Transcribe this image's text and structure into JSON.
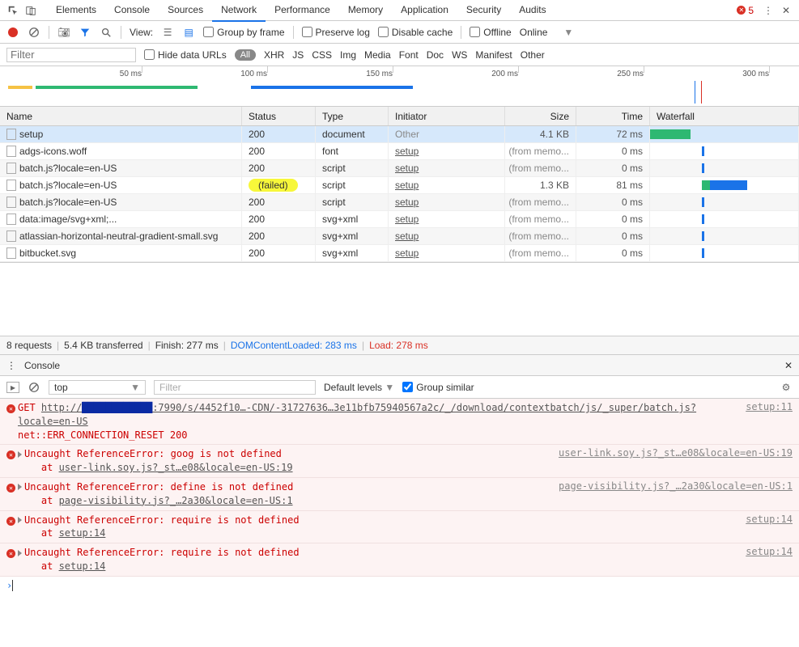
{
  "header": {
    "tabs": [
      "Elements",
      "Console",
      "Sources",
      "Network",
      "Performance",
      "Memory",
      "Application",
      "Security",
      "Audits"
    ],
    "active_tab": "Network",
    "error_count": "5"
  },
  "toolbar": {
    "view_label": "View:",
    "group_by_frame": "Group by frame",
    "preserve_log": "Preserve log",
    "disable_cache": "Disable cache",
    "offline": "Offline",
    "online": "Online"
  },
  "filter": {
    "placeholder": "Filter",
    "hide_data_urls": "Hide data URLs",
    "types": [
      "All",
      "XHR",
      "JS",
      "CSS",
      "Img",
      "Media",
      "Font",
      "Doc",
      "WS",
      "Manifest",
      "Other"
    ],
    "active_type": "All"
  },
  "timeline": {
    "ticks": [
      "50 ms",
      "100 ms",
      "150 ms",
      "200 ms",
      "250 ms",
      "300 ms"
    ]
  },
  "columns": {
    "name": "Name",
    "status": "Status",
    "type": "Type",
    "initiator": "Initiator",
    "size": "Size",
    "time": "Time",
    "waterfall": "Waterfall"
  },
  "rows": [
    {
      "name": "setup",
      "status": "200",
      "type": "document",
      "initiator": "Other",
      "init_link": false,
      "size": "4.1 KB",
      "time": "72 ms",
      "sel": true,
      "wf": {
        "l": 0,
        "w": 50,
        "c": "#2eb872"
      }
    },
    {
      "name": "adgs-icons.woff",
      "status": "200",
      "type": "font",
      "initiator": "setup",
      "init_link": true,
      "size": "(from memo...",
      "time": "0 ms",
      "wf": {
        "l": 64,
        "w": 3,
        "c": "#1a73e8"
      }
    },
    {
      "name": "batch.js?locale=en-US",
      "status": "200",
      "type": "script",
      "initiator": "setup",
      "init_link": true,
      "size": "(from memo...",
      "time": "0 ms",
      "alt": true,
      "wf": {
        "l": 64,
        "w": 3,
        "c": "#1a73e8"
      }
    },
    {
      "name": "batch.js?locale=en-US",
      "status": "(failed)",
      "hl": true,
      "type": "script",
      "initiator": "setup",
      "init_link": true,
      "size": "1.3 KB",
      "time": "81 ms",
      "wf": {
        "l": 64,
        "w": 56,
        "c": "#1a73e8",
        "g": 10
      }
    },
    {
      "name": "batch.js?locale=en-US",
      "status": "200",
      "type": "script",
      "initiator": "setup",
      "init_link": true,
      "size": "(from memo...",
      "time": "0 ms",
      "alt": true,
      "wf": {
        "l": 64,
        "w": 3,
        "c": "#1a73e8"
      }
    },
    {
      "name": "data:image/svg+xml;...",
      "status": "200",
      "type": "svg+xml",
      "initiator": "setup",
      "init_link": true,
      "size": "(from memo...",
      "time": "0 ms",
      "wf": {
        "l": 64,
        "w": 3,
        "c": "#1a73e8"
      }
    },
    {
      "name": "atlassian-horizontal-neutral-gradient-small.svg",
      "status": "200",
      "type": "svg+xml",
      "initiator": "setup",
      "init_link": true,
      "size": "(from memo...",
      "time": "0 ms",
      "alt": true,
      "wf": {
        "l": 64,
        "w": 3,
        "c": "#1a73e8"
      }
    },
    {
      "name": "bitbucket.svg",
      "status": "200",
      "type": "svg+xml",
      "initiator": "setup",
      "init_link": true,
      "size": "(from memo...",
      "time": "0 ms",
      "wf": {
        "l": 64,
        "w": 3,
        "c": "#1a73e8"
      }
    }
  ],
  "status": {
    "requests": "8 requests",
    "transferred": "5.4 KB transferred",
    "finish": "Finish: 277 ms",
    "dcl": "DOMContentLoaded: 283 ms",
    "load": "Load: 278 ms"
  },
  "console": {
    "title": "Console",
    "context": "top",
    "filter_placeholder": "Filter",
    "levels": "Default levels",
    "group_similar": "Group similar",
    "entries": [
      {
        "type": "err",
        "text": "GET ",
        "url": "http://",
        "redact": true,
        "url_tail": ":7990/s/4452f10…-CDN/-31727636…3e11bfb75940567a2c/_/download/contextbatch/js/_super/batch.js?locale=en-US",
        "sub": "net::ERR_CONNECTION_RESET 200",
        "src": "setup:11"
      },
      {
        "type": "err",
        "expand": true,
        "text": "Uncaught ReferenceError: goog is not defined",
        "at": "user-link.soy.js?_st…e08&locale=en-US:19",
        "src": "user-link.soy.js?_st…e08&locale=en-US:19"
      },
      {
        "type": "err",
        "expand": true,
        "text": "Uncaught ReferenceError: define is not defined",
        "at": "page-visibility.js?_…2a30&locale=en-US:1",
        "src": "page-visibility.js?_…2a30&locale=en-US:1"
      },
      {
        "type": "err",
        "expand": true,
        "text": "Uncaught ReferenceError: require is not defined",
        "at": "setup:14",
        "src": "setup:14"
      },
      {
        "type": "err",
        "expand": true,
        "text": "Uncaught ReferenceError: require is not defined",
        "at": "setup:14",
        "src": "setup:14"
      }
    ]
  }
}
